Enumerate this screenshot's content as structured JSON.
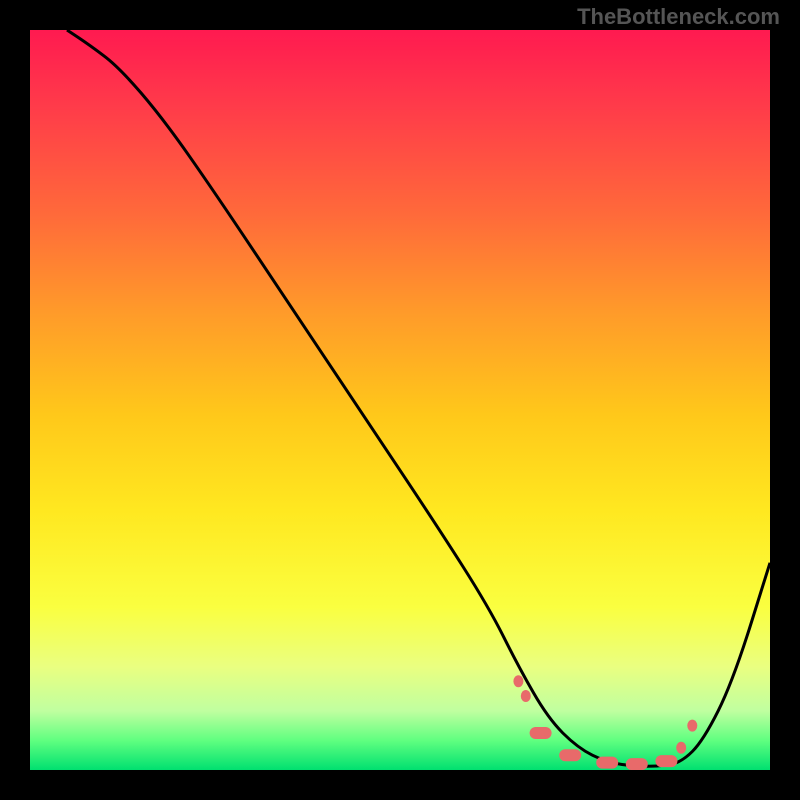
{
  "watermark": "TheBottleneck.com",
  "chart_data": {
    "type": "line",
    "title": "",
    "xlabel": "",
    "ylabel": "",
    "xlim": [
      0,
      100
    ],
    "ylim": [
      0,
      100
    ],
    "grid": false,
    "legend": false,
    "series": [
      {
        "name": "curve",
        "color": "#000000",
        "x": [
          5,
          8,
          12,
          18,
          25,
          35,
          45,
          55,
          62,
          66,
          70,
          74,
          78,
          82,
          85,
          88,
          91,
          95,
          100
        ],
        "y": [
          100,
          98,
          95,
          88,
          78,
          63,
          48,
          33,
          22,
          14,
          7,
          3,
          1,
          0.5,
          0.5,
          1,
          4,
          12,
          28
        ]
      }
    ],
    "markers": {
      "name": "highlight",
      "color": "#e86a6a",
      "shape": "rounded-segments",
      "x": [
        66,
        67,
        69,
        73,
        78,
        82,
        86,
        88,
        89.5
      ],
      "y": [
        12,
        10,
        5,
        2,
        1,
        0.8,
        1.2,
        3,
        6
      ]
    }
  }
}
